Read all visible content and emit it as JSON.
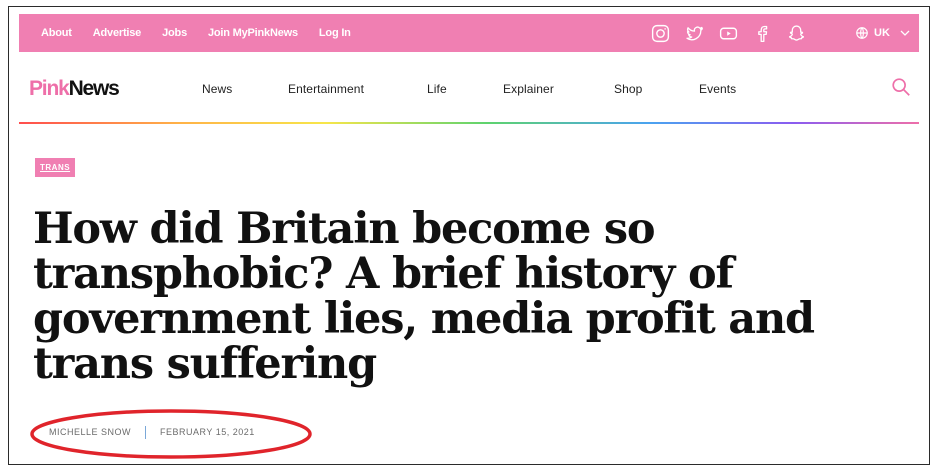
{
  "topbar": {
    "links": [
      "About",
      "Advertise",
      "Jobs",
      "Join MyPinkNews",
      "Log In"
    ],
    "social_icons": [
      "instagram-icon",
      "twitter-icon",
      "youtube-icon",
      "facebook-icon",
      "snapchat-icon"
    ],
    "locale": "UK",
    "bg_color": "#f07fb2"
  },
  "header": {
    "logo_part1": "Pink",
    "logo_part2": "News",
    "nav": [
      "News",
      "Entertainment",
      "Life",
      "Explainer",
      "Shop",
      "Events"
    ],
    "search_icon": "search-icon",
    "accent_color": "#ee6fa9"
  },
  "article": {
    "tag": "TRANS",
    "headline": "How did Britain become so transphobic? A brief history of government lies, media profit and trans suffering",
    "author": "MICHELLE SNOW",
    "date": "FEBRUARY 15, 2021"
  },
  "annotation": {
    "oval_color": "#e0242b"
  }
}
